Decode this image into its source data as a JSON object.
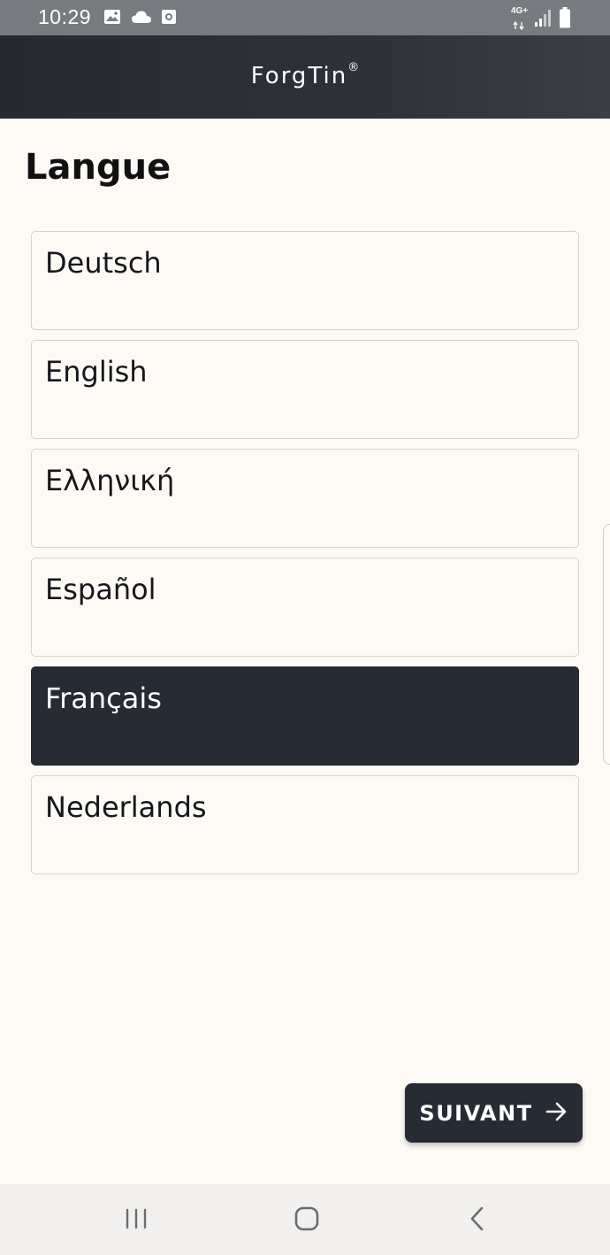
{
  "status_bar": {
    "time": "10:29",
    "icons": [
      "gallery-icon",
      "cloud-icon",
      "app-notification-icon"
    ],
    "network": "4G+",
    "right_icons": [
      "signal-icon",
      "battery-icon"
    ]
  },
  "header": {
    "logo_text": "ForgTin",
    "logo_mark": "®"
  },
  "page": {
    "title": "Langue"
  },
  "languages": [
    {
      "label": "Deutsch",
      "selected": false
    },
    {
      "label": "English",
      "selected": false
    },
    {
      "label": "Ελληνική",
      "selected": false
    },
    {
      "label": "Español",
      "selected": false
    },
    {
      "label": "Français",
      "selected": true
    },
    {
      "label": "Nederlands",
      "selected": false
    }
  ],
  "actions": {
    "next_label": "SUIVANT",
    "next_icon": "arrow-right-icon"
  },
  "nav_bar": {
    "buttons": [
      "recent-apps-icon",
      "home-icon",
      "back-icon"
    ]
  },
  "colors": {
    "background": "#fdfaf6",
    "header": "#2e3238",
    "selected": "#272b33",
    "button": "#272b33"
  }
}
